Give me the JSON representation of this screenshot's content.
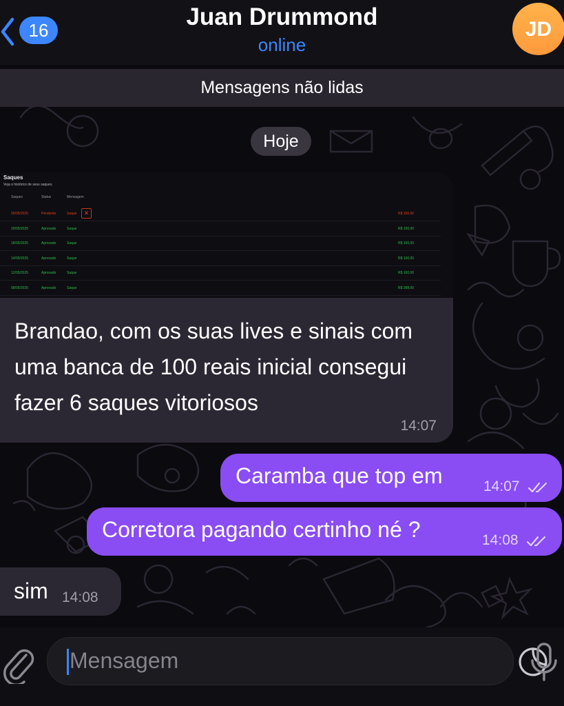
{
  "header": {
    "unread_count": "16",
    "title": "Juan Drummond",
    "status": "online",
    "avatar_initials": "JD"
  },
  "banner": {
    "unread_label": "Mensagens não lidas"
  },
  "date_separator": "Hoje",
  "embedded_screenshot": {
    "title": "Saques",
    "subtitle": "Veja o histórico de seus saques.",
    "columns": [
      "Saques",
      "Status",
      "Mensagem"
    ],
    "rows": [
      {
        "date": "25/05/2025",
        "status": "Pendente",
        "message": "Saque",
        "amount": "R$ 100,00",
        "state": "pending"
      },
      {
        "date": "20/05/2025",
        "status": "Aprovado",
        "message": "Saque",
        "amount": "R$ 100,00",
        "state": "approved"
      },
      {
        "date": "18/05/2025",
        "status": "Aprovado",
        "message": "Saque",
        "amount": "R$ 100,00",
        "state": "approved"
      },
      {
        "date": "14/05/2025",
        "status": "Aprovado",
        "message": "Saque",
        "amount": "R$ 100,00",
        "state": "approved"
      },
      {
        "date": "12/05/2025",
        "status": "Aprovado",
        "message": "Saque",
        "amount": "R$ 100,00",
        "state": "approved"
      },
      {
        "date": "08/05/2025",
        "status": "Aprovado",
        "message": "Saque",
        "amount": "R$ 288,00",
        "state": "approved"
      }
    ]
  },
  "messages": {
    "m1": {
      "text": "Brandao, com os suas lives e sinais com uma banca de 100 reais inicial consegui fazer 6 saques vitoriosos",
      "time": "14:07"
    },
    "m2": {
      "text": "Caramba que top em",
      "time": "14:07"
    },
    "m3": {
      "text": "Corretora pagando certinho né ?",
      "time": "14:08"
    },
    "m4": {
      "text": "sim",
      "time": "14:08"
    }
  },
  "composer": {
    "placeholder": "Mensagem"
  },
  "colors": {
    "accent_blue": "#3c86ff",
    "outgoing_bubble": "#8a4cf3",
    "incoming_bubble": "#2c2833",
    "avatar": "#ff9a3c",
    "pending_red": "#e0401a",
    "approved_green": "#2fbf4a"
  },
  "icons": [
    "chevron-left-icon",
    "paperclip-icon",
    "sticker-icon",
    "microphone-icon",
    "double-check-icon",
    "close-icon"
  ]
}
